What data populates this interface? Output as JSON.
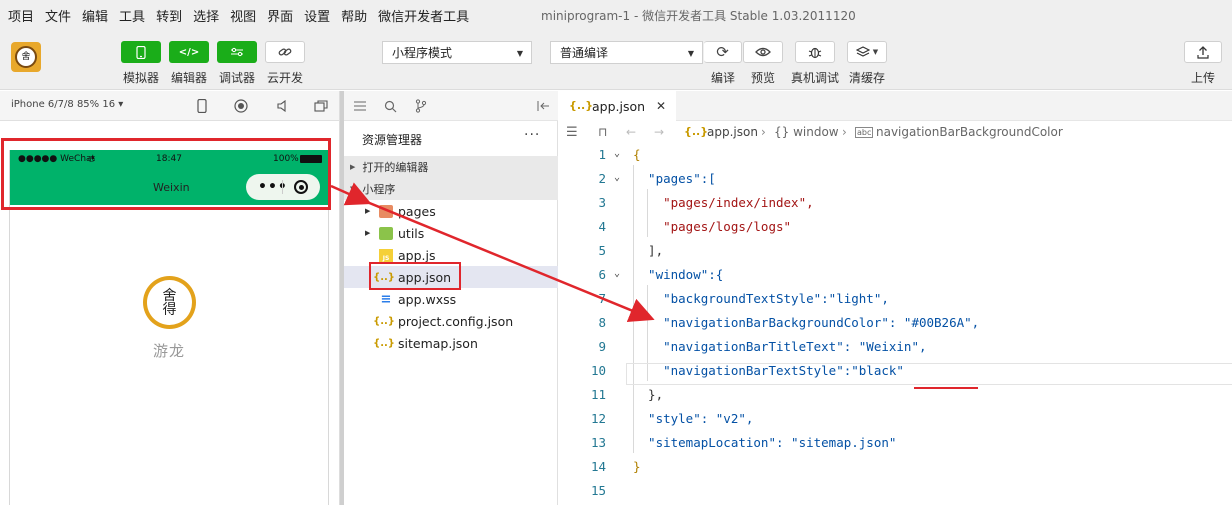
{
  "menubar": {
    "items": [
      "项目",
      "文件",
      "编辑",
      "工具",
      "转到",
      "选择",
      "视图",
      "界面",
      "设置",
      "帮助",
      "微信开发者工具"
    ],
    "window_title": "miniprogram-1 - 微信开发者工具 Stable 1.03.2011120"
  },
  "toolbar": {
    "simulator_label": "模拟器",
    "editor_label": "编辑器",
    "debugger_label": "调试器",
    "cloud_label": "云开发",
    "mode_select": "小程序模式",
    "compile_select": "普通编译",
    "compile_label": "编译",
    "preview_label": "预览",
    "realdebug_label": "真机调试",
    "clearcache_label": "清缓存",
    "upload_label": "上传"
  },
  "simulator": {
    "device": "iPhone 6/7/8 85% 16 ▾",
    "carrier": "●●●●● WeChat",
    "time": "18:47",
    "battery": "100%",
    "nav_title": "Weixin",
    "app_name": "游龙",
    "nav_color": "#00B26A"
  },
  "explorer": {
    "title": "资源管理器",
    "open_editors": "打开的编辑器",
    "project": "小程序",
    "files": [
      {
        "name": "pages",
        "type": "folder"
      },
      {
        "name": "utils",
        "type": "folder"
      },
      {
        "name": "app.js",
        "type": "js"
      },
      {
        "name": "app.json",
        "type": "json"
      },
      {
        "name": "app.wxss",
        "type": "wxss"
      },
      {
        "name": "project.config.json",
        "type": "json"
      },
      {
        "name": "sitemap.json",
        "type": "json"
      }
    ]
  },
  "editor": {
    "tab_name": "app.json",
    "breadcrumb": [
      "app.json",
      "{} window",
      "navigationBarBackgroundColor"
    ],
    "line_numbers": [
      "1",
      "2",
      "3",
      "4",
      "5",
      "6",
      "7",
      "8",
      "9",
      "10",
      "11",
      "12",
      "13",
      "14",
      "15"
    ],
    "lines": [
      "{",
      "  \"pages\":[",
      "    \"pages/index/index\",",
      "    \"pages/logs/logs\"",
      "  ],",
      "  \"window\":{",
      "    \"backgroundTextStyle\":\"light\",",
      "    \"navigationBarBackgroundColor\": \"#00B26A\",",
      "    \"navigationBarTitleText\": \"Weixin\",",
      "    \"navigationBarTextStyle\":\"black\"",
      "  },",
      "  \"style\": \"v2\",",
      "  \"sitemapLocation\": \"sitemap.json\"",
      "}",
      ""
    ]
  },
  "colors": {
    "accent_green": "#1aad19",
    "annotation_red": "#e0262c"
  }
}
